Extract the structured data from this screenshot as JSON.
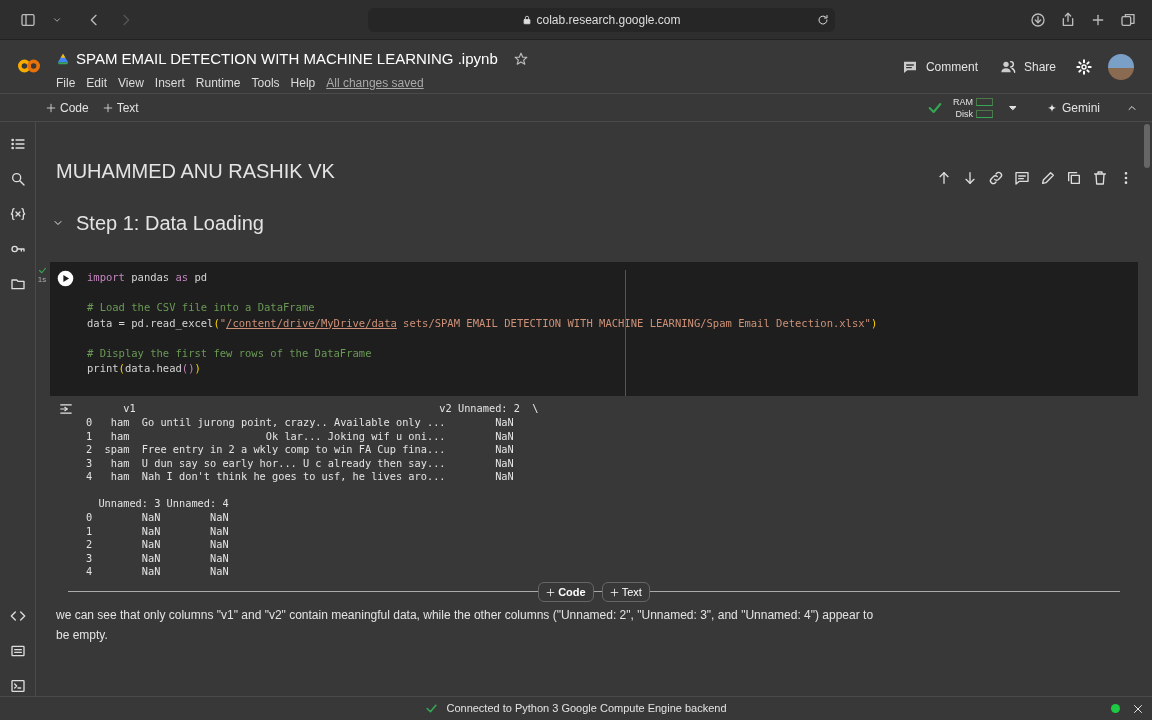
{
  "browser": {
    "url": "colab.research.google.com"
  },
  "notebook": {
    "title": "SPAM EMAIL DETECTION WITH MACHINE LEARNING .ipynb",
    "menu": [
      "File",
      "Edit",
      "View",
      "Insert",
      "Runtime",
      "Tools",
      "Help"
    ],
    "save_status": "All changes saved"
  },
  "header_actions": {
    "comment": "Comment",
    "share": "Share"
  },
  "toolbar": {
    "add_code": "Code",
    "add_text": "Text",
    "ram": "RAM",
    "disk": "Disk",
    "gemini": "Gemini"
  },
  "cells": [
    {
      "kind": "title",
      "text": "MUHAMMED ANU RASHIK VK"
    },
    {
      "kind": "heading",
      "text": "Step 1: Data Loading",
      "expanded": true
    },
    {
      "kind": "code",
      "run_time": "1s",
      "code_blocks": [
        [
          [
            {
              "kind": "keyword",
              "text": "import"
            },
            {
              "kind": "plain",
              "text": " pandas "
            },
            {
              "kind": "keyword",
              "text": "as"
            },
            {
              "kind": "plain",
              "text": " pd"
            }
          ]
        ],
        [
          [
            {
              "kind": "comment",
              "text": "# Load the CSV file into a DataFrame"
            }
          ],
          [
            {
              "kind": "plain",
              "text": "data = pd.read_excel"
            },
            {
              "kind": "paren",
              "text": "("
            },
            {
              "kind": "string",
              "text": "\""
            },
            {
              "kind": "link",
              "text": "/content/drive/MyDrive/data"
            },
            {
              "kind": "string",
              "text": " sets/SPAM EMAIL DETECTION WITH MACHINE LEARNING/Spam Email Detection.xlsx\""
            },
            {
              "kind": "paren",
              "text": ")"
            }
          ]
        ],
        [
          [
            {
              "kind": "comment",
              "text": "# Display the first few rows of the DataFrame"
            }
          ],
          [
            {
              "kind": "plain",
              "text": "print"
            },
            {
              "kind": "paren",
              "text": "("
            },
            {
              "kind": "plain",
              "text": "data.head"
            },
            {
              "kind": "keyword",
              "text": "()"
            },
            {
              "kind": "paren",
              "text": ")"
            }
          ]
        ]
      ],
      "output_blocks": [
        [
          "      v1                                                 v2 Unnamed: 2  \\",
          "0   ham  Go until jurong point, crazy.. Available only ...        NaN",
          "1   ham                      Ok lar... Joking wif u oni...        NaN",
          "2  spam  Free entry in 2 a wkly comp to win FA Cup fina...        NaN",
          "3   ham  U dun say so early hor... U c already then say...        NaN",
          "4   ham  Nah I don't think he goes to usf, he lives aro...        NaN"
        ],
        [
          "  Unnamed: 3 Unnamed: 4",
          "0        NaN        NaN",
          "1        NaN        NaN",
          "2        NaN        NaN",
          "3        NaN        NaN",
          "4        NaN        NaN"
        ]
      ]
    },
    {
      "kind": "add_bar",
      "code": "Code",
      "text": "Text"
    },
    {
      "kind": "markdown",
      "text": "we can see that only columns \"v1\" and \"v2\" contain meaningful data, while the other columns (\"Unnamed: 2\", \"Unnamed: 3\", and \"Unnamed: 4\") appear to be empty."
    }
  ],
  "status_bar": {
    "text": "Connected to Python 3 Google Compute Engine backend"
  }
}
